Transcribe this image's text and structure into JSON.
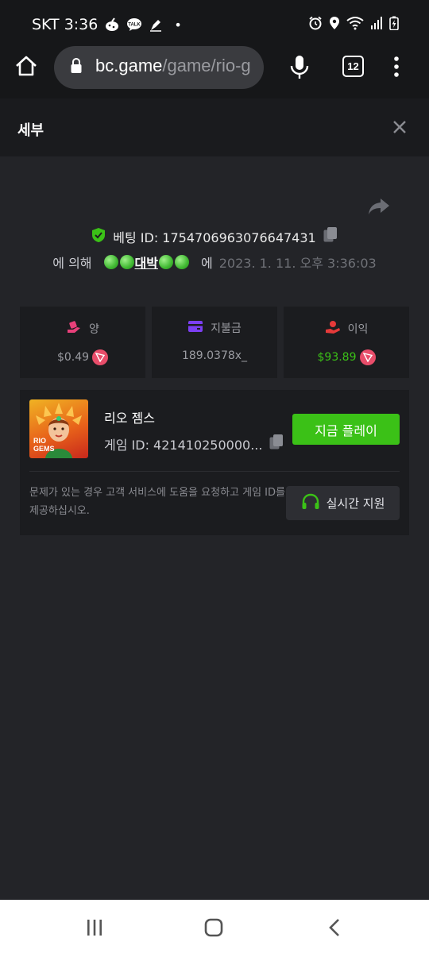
{
  "status_bar": {
    "carrier_time": "SKT 3:36",
    "dot": "•",
    "icons": [
      "cookie-icon",
      "talk-icon",
      "pen-icon",
      "alarm-icon",
      "location-icon",
      "wifi-icon",
      "signal-icon",
      "battery-icon"
    ]
  },
  "browser": {
    "url_host": "bc.game",
    "url_path": "/game/rio-g",
    "tab_count": "12"
  },
  "header": {
    "title": "세부"
  },
  "bet": {
    "id_label": "베팅 ID: 1754706963076647431",
    "by_label": "에 의해",
    "user_name": "대박",
    "at_label": "에",
    "date": "2023. 1. 11. 오후 3:36:03"
  },
  "stats": [
    {
      "label": "양",
      "value": "$0.49",
      "icon": "bet-amount-icon",
      "color": "#e8407a"
    },
    {
      "label": "지불금",
      "value": "189.0378x_",
      "icon": "wallet-icon",
      "color": "#7c3ff2"
    },
    {
      "label": "이익",
      "value": "$93.89",
      "icon": "profit-icon",
      "color": "#e63a3a"
    }
  ],
  "game": {
    "name": "리오 젬스",
    "id_label": "게임 ID: 421410250000...",
    "thumb_text_1": "RIO",
    "thumb_text_2": "GEMS",
    "play_label": "지금 플레이",
    "help_text": "문제가 있는 경우 고객 서비스에 도움을 요청하고 게임 ID를 제공하십시오.",
    "support_label": "실시간 지원"
  },
  "colors": {
    "accent_green": "#3bc117",
    "background": "#232428",
    "card": "#1b1c1f"
  }
}
